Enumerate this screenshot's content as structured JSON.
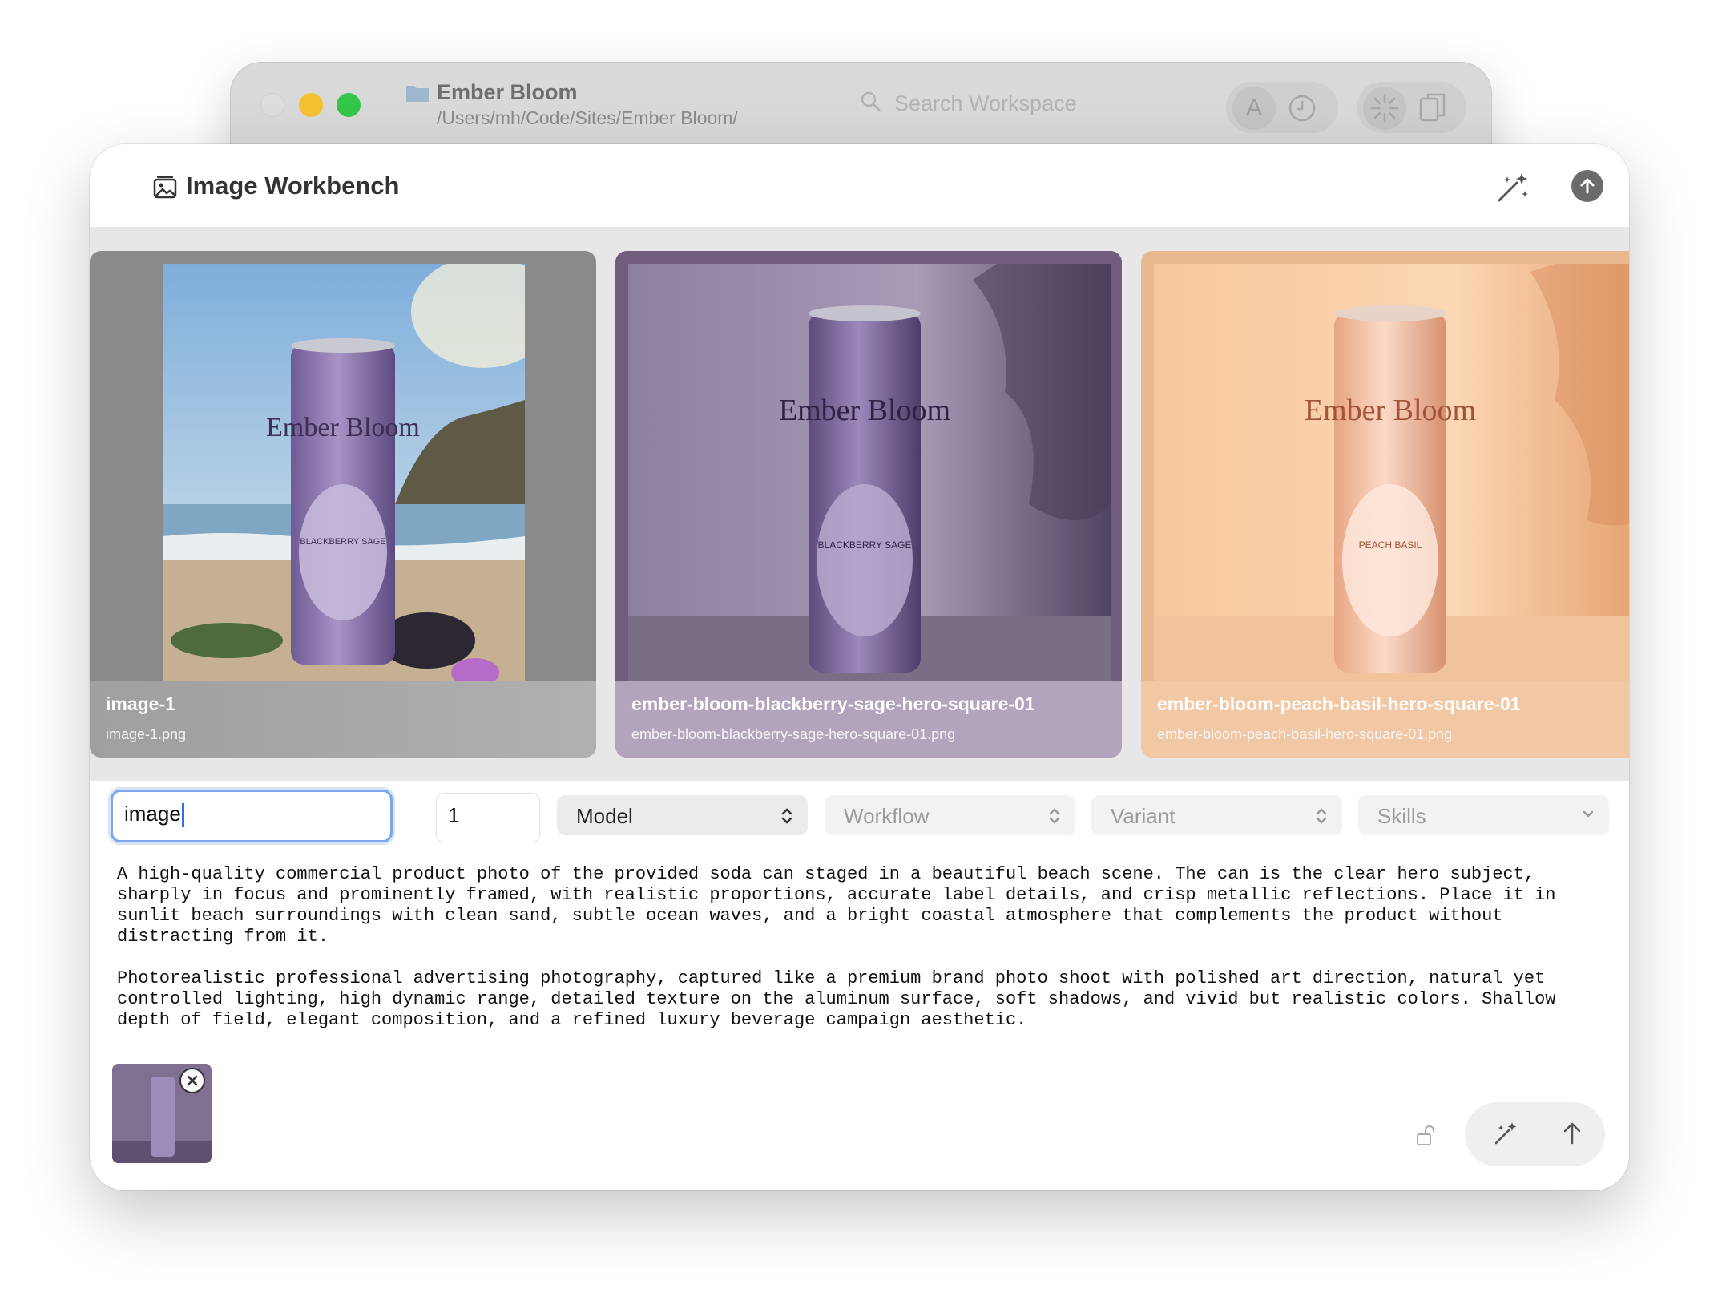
{
  "back_window": {
    "project_name": "Ember Bloom",
    "project_path": "/Users/mh/Code/Sites/Ember Bloom/",
    "search_placeholder": "Search Workspace",
    "avatar_letter": "A"
  },
  "workbench": {
    "title": "Image Workbench"
  },
  "gallery": [
    {
      "title": "image-1",
      "filename": "image-1.png",
      "can_brand": "Ember Bloom",
      "can_flavor": "BLACKBERRY SAGE"
    },
    {
      "title": "ember-bloom-blackberry-sage-hero-square-01",
      "filename": "ember-bloom-blackberry-sage-hero-square-01.png",
      "can_brand": "Ember Bloom",
      "can_flavor": "BLACKBERRY SAGE"
    },
    {
      "title": "ember-bloom-peach-basil-hero-square-01",
      "filename": "ember-bloom-peach-basil-hero-square-01.png",
      "can_brand": "Ember Bloom",
      "can_flavor": "PEACH BASIL"
    }
  ],
  "controls": {
    "name_value": "image",
    "count_value": "1",
    "model_label": "Model",
    "workflow_label": "Workflow",
    "variant_label": "Variant",
    "skills_label": "Skills"
  },
  "prompt": {
    "text": "A high-quality commercial product photo of the provided soda can staged in a beautiful beach scene. The can is the clear hero subject,\nsharply in focus and prominently framed, with realistic proportions, accurate label details, and crisp metallic reflections. Place it in\nsunlit beach surroundings with clean sand, subtle ocean waves, and a bright coastal atmosphere that complements the product without\ndistracting from it.\n\nPhotorealistic professional advertising photography, captured like a premium brand photo shoot with polished art direction, natural yet\ncontrolled lighting, high dynamic range, detailed texture on the aluminum surface, soft shadows, and vivid but realistic colors. Shallow\ndepth of field, elegant composition, and a refined luxury beverage campaign aesthetic."
  },
  "colors": {
    "accent_focus": "#7ea6ec",
    "traffic_yellow": "#f6c033",
    "traffic_green": "#33c748"
  }
}
